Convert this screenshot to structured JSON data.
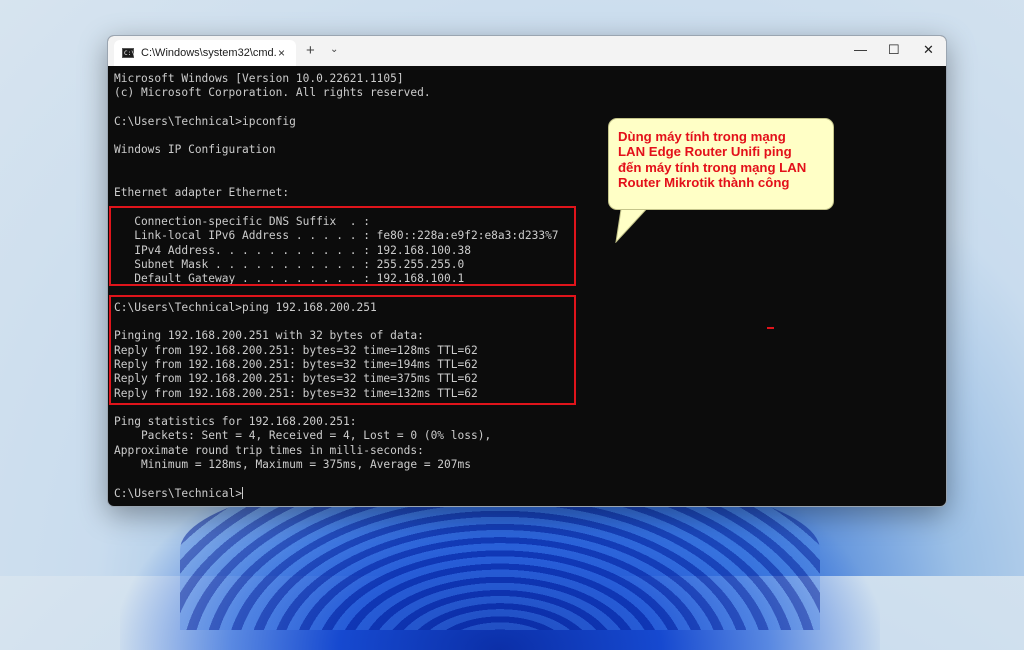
{
  "window": {
    "tab_title": "C:\\Windows\\system32\\cmd.e:",
    "tab_icon_text": "C:\\",
    "tab_close": "×",
    "new_tab": "+",
    "dropdown": "⌄",
    "minimize": "—",
    "maximize": "☐",
    "close": "✕"
  },
  "terminal": {
    "lines": [
      "Microsoft Windows [Version 10.0.22621.1105]",
      "(c) Microsoft Corporation. All rights reserved.",
      "",
      "C:\\Users\\Technical>ipconfig",
      "",
      "Windows IP Configuration",
      "",
      "",
      "Ethernet adapter Ethernet:",
      "",
      "   Connection-specific DNS Suffix  . :",
      "   Link-local IPv6 Address . . . . . : fe80::228a:e9f2:e8a3:d233%7",
      "   IPv4 Address. . . . . . . . . . . : 192.168.100.38",
      "   Subnet Mask . . . . . . . . . . . : 255.255.255.0",
      "   Default Gateway . . . . . . . . . : 192.168.100.1",
      "",
      "C:\\Users\\Technical>ping 192.168.200.251",
      "",
      "Pinging 192.168.200.251 with 32 bytes of data:",
      "Reply from 192.168.200.251: bytes=32 time=128ms TTL=62",
      "Reply from 192.168.200.251: bytes=32 time=194ms TTL=62",
      "Reply from 192.168.200.251: bytes=32 time=375ms TTL=62",
      "Reply from 192.168.200.251: bytes=32 time=132ms TTL=62",
      "",
      "Ping statistics for 192.168.200.251:",
      "    Packets: Sent = 4, Received = 4, Lost = 0 (0% loss),",
      "Approximate round trip times in milli-seconds:",
      "    Minimum = 128ms, Maximum = 375ms, Average = 207ms",
      "",
      "C:\\Users\\Technical>"
    ]
  },
  "callout": {
    "lines": [
      "Dùng máy tính trong mạng",
      "LAN Edge Router Unifi ping",
      "đến máy tính trong mạng LAN",
      "Router Mikrotik thành công"
    ]
  },
  "colors": {
    "highlight": "#e0141b",
    "callout_text": "#e3101a",
    "callout_bg": "#ffffc6",
    "terminal_bg": "#0c0c0c",
    "terminal_text": "#cccccc"
  }
}
